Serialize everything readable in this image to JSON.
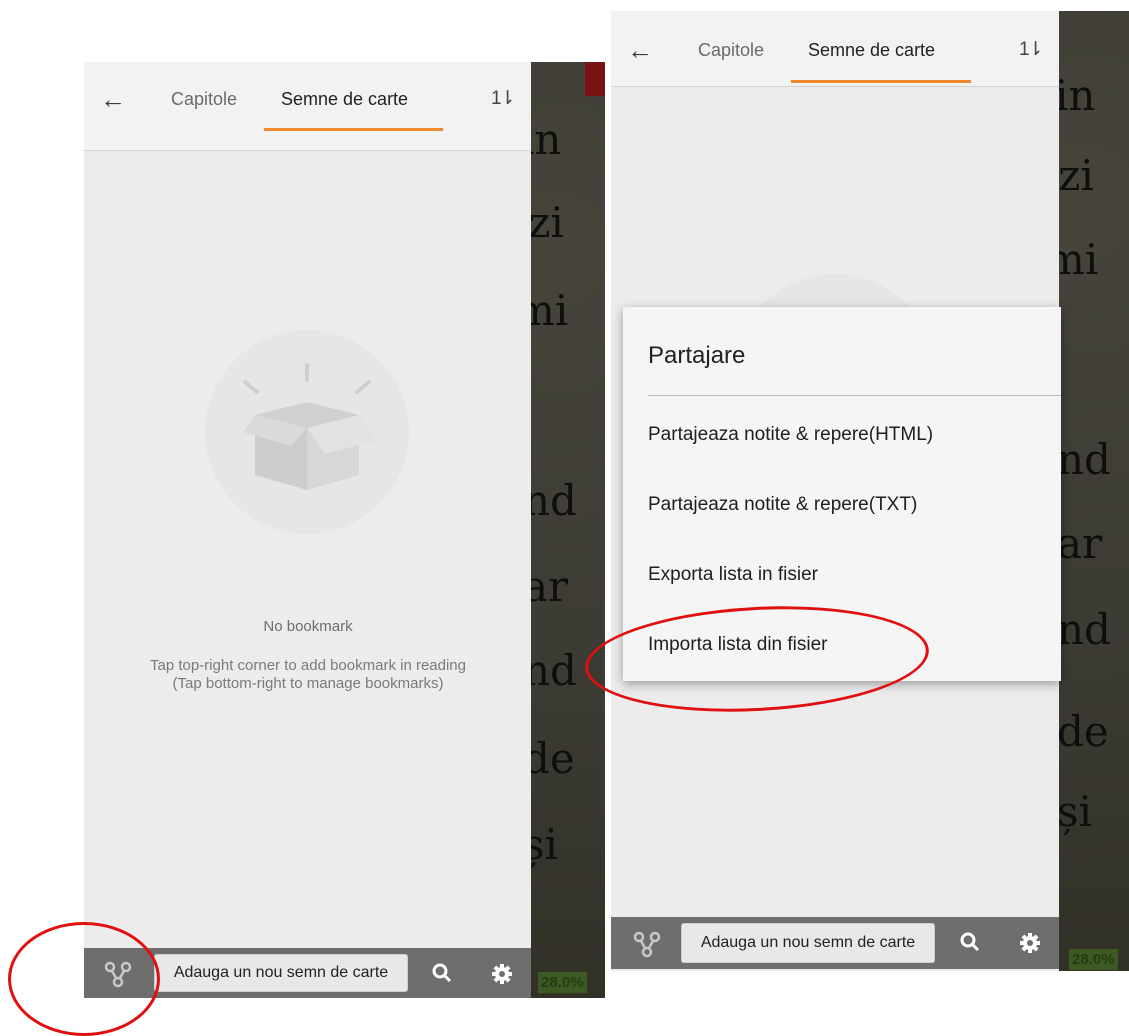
{
  "left_screen": {
    "book_words": [
      "in",
      "ozi",
      "mi",
      "nd",
      "ar",
      "nd",
      "de",
      "și"
    ],
    "progress": "28.0%",
    "tabs": [
      {
        "label": "Capitole",
        "active": false
      },
      {
        "label": "Semne de carte",
        "active": true
      }
    ],
    "empty_state": {
      "title": "No bookmark",
      "hint_line1": "Tap top-right corner to add bookmark in reading",
      "hint_line2": "(Tap bottom-right to manage bookmarks)"
    },
    "bottom_bar": {
      "add_label": "Adauga un nou semn de carte"
    }
  },
  "right_screen": {
    "book_words": [
      "in",
      "ozi",
      "mi",
      "nd",
      "ar",
      "nd",
      "de",
      "și"
    ],
    "progress": "28.0%",
    "tabs": [
      {
        "label": "Capitole",
        "active": false
      },
      {
        "label": "Semne de carte",
        "active": true
      }
    ],
    "menu": {
      "title": "Partajare",
      "items": [
        "Partajeaza notite & repere(HTML)",
        "Partajeaza notite & repere(TXT)",
        "Exporta lista in fisier",
        "Importa lista din fisier"
      ]
    },
    "bottom_bar": {
      "add_label": "Adauga un nou semn de carte"
    }
  },
  "icons": {
    "back": "arrow-left-icon",
    "sort": "sort-icon",
    "share": "share-icon",
    "search": "search-icon",
    "settings": "gear-icon",
    "empty": "open-box-icon"
  },
  "colors": {
    "accent": "#ef8a2c",
    "bottom_bar": "#6e6e6e",
    "highlight_oval": "#e01010",
    "book_bg": "#3b3a33"
  }
}
